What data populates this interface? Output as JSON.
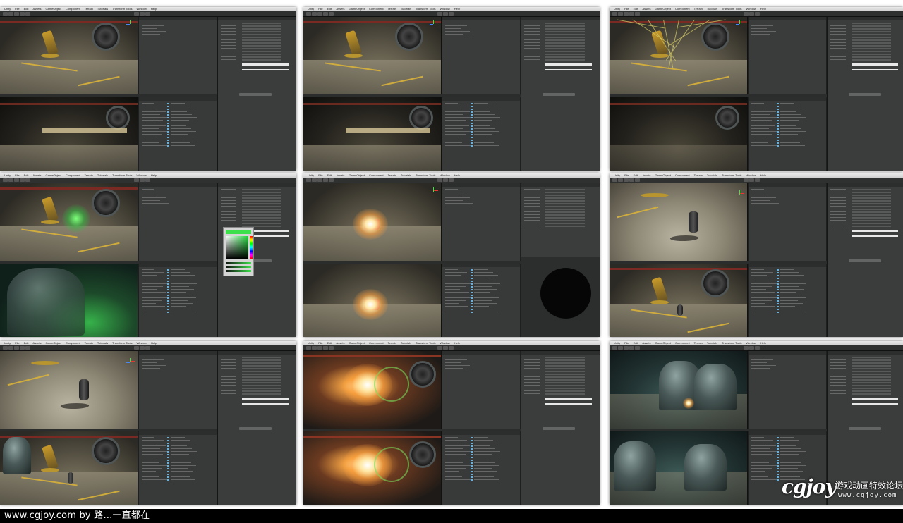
{
  "menubar": {
    "items": [
      "Unity",
      "File",
      "Edit",
      "Assets",
      "GameObject",
      "Component",
      "Terrain",
      "Tutorials",
      "Transform Tools",
      "Window",
      "Help"
    ]
  },
  "tiles": [
    {
      "id": "r1c1",
      "scene": "hangar-robot-arm",
      "game": "hangar-dark-fan"
    },
    {
      "id": "r1c2",
      "scene": "hangar-robot-arm",
      "game": "hangar-dark-fan"
    },
    {
      "id": "r1c3",
      "scene": "hangar-wireframe-lights",
      "game": "hangar-unlit"
    },
    {
      "id": "r2c1",
      "scene": "hangar-green-light",
      "game": "tunnel-green-glow",
      "overlay": "color-picker"
    },
    {
      "id": "r2c2",
      "scene": "hangar-red-turret",
      "game": "hangar-lit-turret",
      "overlay": "material-preview"
    },
    {
      "id": "r2c3",
      "scene": "floor-cylinder-shadow",
      "game": "hangar-robot-cylinder"
    },
    {
      "id": "r3c1",
      "scene": "floor-cylinder-top",
      "game": "hangar-domes-robot"
    },
    {
      "id": "r3c2",
      "scene": "hangar-explosion-flare",
      "game": "hangar-fire-flare"
    },
    {
      "id": "r3c3",
      "scene": "domes-point-light",
      "game": "domes-closeup"
    }
  ],
  "caption": {
    "text": "www.cgjoy.com by 路…一直都在"
  },
  "watermark": {
    "logo": "cgjoy",
    "tagline": "游戏动画特效论坛",
    "url": "www.cgjoy.com"
  },
  "colors": {
    "editor_bg": "#3b3c3c",
    "caption_bg": "#000000",
    "accent_green": "#3be04a",
    "hazard_yellow": "#d9b33a"
  }
}
